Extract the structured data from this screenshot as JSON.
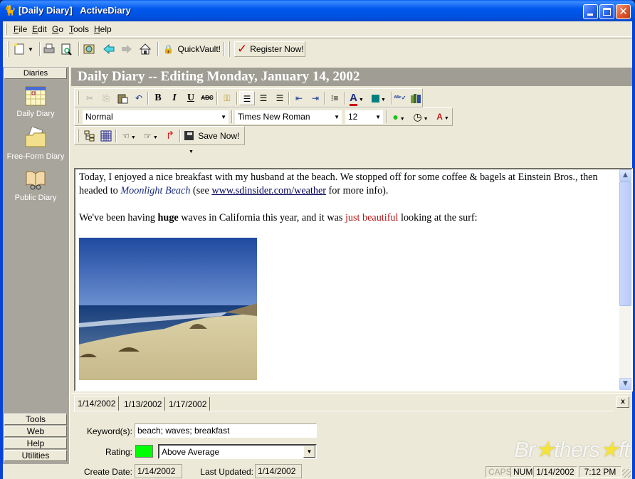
{
  "window": {
    "title": "[Daily Diary]   ActiveDiary",
    "title_icon": "diary-app-icon",
    "controls": [
      "minimize",
      "maximize",
      "close"
    ]
  },
  "menubar": {
    "items": [
      {
        "label": "File",
        "accel": "F"
      },
      {
        "label": "Edit",
        "accel": "E"
      },
      {
        "label": "Go",
        "accel": "G"
      },
      {
        "label": "Tools",
        "accel": "T"
      },
      {
        "label": "Help",
        "accel": "H"
      }
    ]
  },
  "toolbar": {
    "new_icon": "new-document-icon",
    "print_icon": "printer-icon",
    "preview_icon": "print-preview-icon",
    "search_icon": "find-icon",
    "back_icon": "back-arrow-icon",
    "forward_icon": "forward-arrow-icon",
    "home_icon": "home-icon",
    "quickvault_label": "QuickVault!",
    "register_label": "Register Now!"
  },
  "sidebar": {
    "header": "Diaries",
    "items": [
      {
        "label": "Daily Diary",
        "icon": "calendar-icon"
      },
      {
        "label": "Free-Form Diary",
        "icon": "folder-icon"
      },
      {
        "label": "Public Diary",
        "icon": "open-book-icon"
      }
    ],
    "bottom_buttons": [
      "Tools",
      "Web",
      "Help",
      "Utilities"
    ]
  },
  "header": {
    "title": "Daily Diary -- Editing Monday, January 14, 2002"
  },
  "format_toolbar": {
    "style_value": "Normal",
    "font_value": "Times New Roman",
    "size_value": "12",
    "save_label": "Save Now!",
    "buttons": [
      "cut",
      "copy",
      "paste",
      "undo",
      "bold",
      "italic",
      "underline",
      "strikethrough",
      "password",
      "align-left",
      "align-center",
      "align-right",
      "outdent",
      "indent",
      "bullets",
      "font-color",
      "highlight-color",
      "spell-check",
      "thesaurus"
    ],
    "font_color": "#cc0000",
    "highlight_color": "#008080"
  },
  "editor": {
    "para1": {
      "a": "Today, I enjoyed a nice breakfast with my husband at the beach. We stopped off for some coffee & bagels at Einstein Bros., then headed to ",
      "italic": "Moonlight Beach",
      "b": " (see ",
      "link": "www.sdinsider.com/weather",
      "c": " for more info)."
    },
    "para2": {
      "a": "We've been having ",
      "bold": "huge",
      "b": " waves in California this year, and it was ",
      "red": "just beautiful",
      "c": " looking at the surf:"
    },
    "image_alt": "beach photo"
  },
  "entry_props": {
    "tabs": [
      "1/14/2002",
      "1/13/2002",
      "1/17/2002"
    ],
    "active_tab": 0,
    "keywords_label": "Keyword(s):",
    "keywords_value": "beach; waves; breakfast",
    "rating_label": "Rating:",
    "rating_color": "#00ff00",
    "rating_value": "Above Average",
    "create_label": "Create Date:",
    "create_value": "1/14/2002",
    "updated_label": "Last Updated:",
    "updated_value": "1/14/2002",
    "close_label": "x"
  },
  "statusbar": {
    "caps": "CAPS",
    "num": "NUM",
    "date": "1/14/2002",
    "time": "7:12 PM"
  },
  "watermark": {
    "pre": "Br",
    "mid": "thers",
    "post": "ft"
  }
}
